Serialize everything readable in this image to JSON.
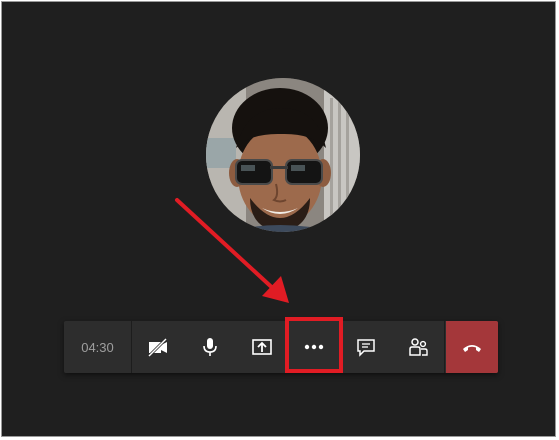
{
  "call": {
    "timer": "04:30"
  },
  "participant": {
    "avatar_alt": "participant-photo"
  },
  "toolbar": {
    "buttons": [
      {
        "id": "camera",
        "icon": "video-off-icon"
      },
      {
        "id": "mic",
        "icon": "microphone-icon"
      },
      {
        "id": "share",
        "icon": "share-screen-icon"
      },
      {
        "id": "more",
        "icon": "more-options-icon",
        "highlighted": true
      },
      {
        "id": "chat",
        "icon": "chat-icon"
      },
      {
        "id": "participants",
        "icon": "participants-icon"
      },
      {
        "id": "hangup",
        "icon": "hang-up-icon"
      }
    ]
  },
  "colors": {
    "background": "#1f1f1f",
    "toolbar": "#2d2d2d",
    "hangup": "#a4373a",
    "annotation_red": "#e11c24",
    "icon": "#ffffff",
    "timer_text": "#9e9e9e"
  }
}
